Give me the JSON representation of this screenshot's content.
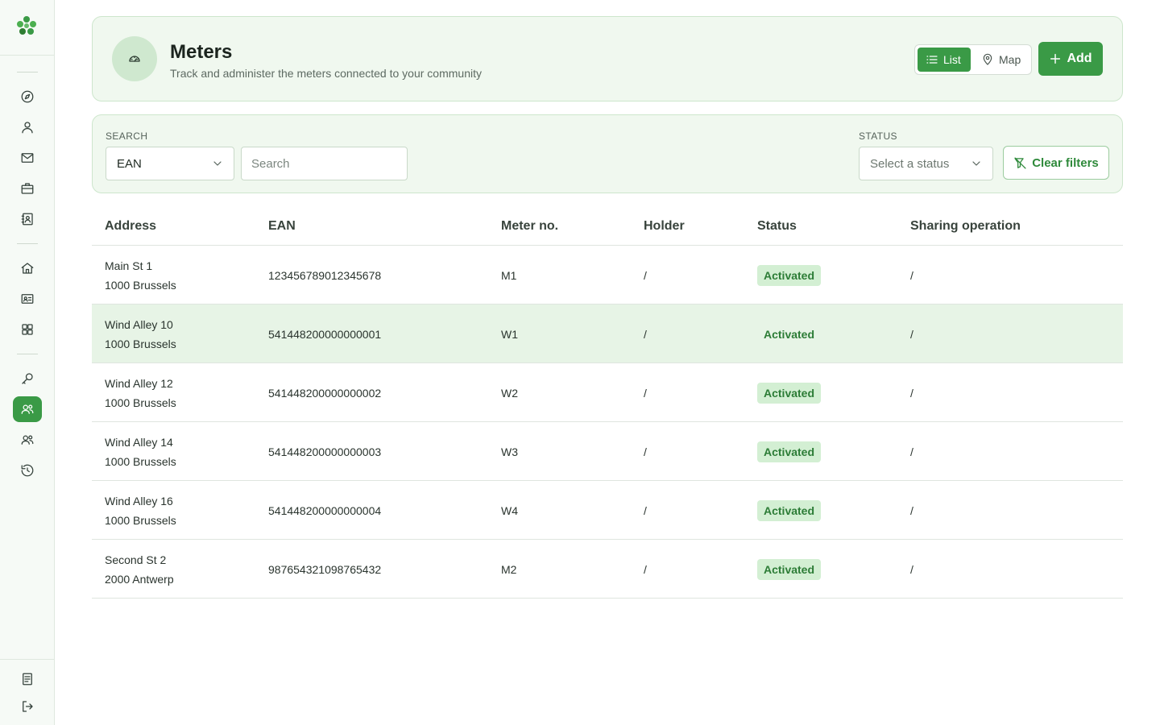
{
  "sidebar": {
    "icons": [
      "compass-icon",
      "user-icon",
      "mail-icon",
      "briefcase-icon",
      "contacts-icon",
      "home-icon",
      "id-card-icon",
      "grid-icon",
      "key-icon",
      "users-icon",
      "group-icon",
      "history-icon",
      "document-icon",
      "logout-icon"
    ],
    "active": "users-icon"
  },
  "header": {
    "title": "Meters",
    "subtitle": "Track and administer the meters connected to your community",
    "view_list_label": "List",
    "view_map_label": "Map",
    "add_label": "Add"
  },
  "filters": {
    "search_label": "SEARCH",
    "search_field_value": "EAN",
    "search_placeholder": "Search",
    "status_label": "STATUS",
    "status_placeholder": "Select a status",
    "clear_label": "Clear filters"
  },
  "table": {
    "columns": [
      "Address",
      "EAN",
      "Meter no.",
      "Holder",
      "Status",
      "Sharing operation"
    ],
    "rows": [
      {
        "address_line1": "Main St 1",
        "address_line2": "1000 Brussels",
        "ean": "123456789012345678",
        "meter": "M1",
        "holder": "/",
        "status": "Activated",
        "sharing": "/"
      },
      {
        "address_line1": "Wind Alley 10",
        "address_line2": "1000 Brussels",
        "ean": "541448200000000001",
        "meter": "W1",
        "holder": "/",
        "status": "Activated",
        "sharing": "/"
      },
      {
        "address_line1": "Wind Alley 12",
        "address_line2": "1000 Brussels",
        "ean": "541448200000000002",
        "meter": "W2",
        "holder": "/",
        "status": "Activated",
        "sharing": "/"
      },
      {
        "address_line1": "Wind Alley 14",
        "address_line2": "1000 Brussels",
        "ean": "541448200000000003",
        "meter": "W3",
        "holder": "/",
        "status": "Activated",
        "sharing": "/"
      },
      {
        "address_line1": "Wind Alley 16",
        "address_line2": "1000 Brussels",
        "ean": "541448200000000004",
        "meter": "W4",
        "holder": "/",
        "status": "Activated",
        "sharing": "/"
      },
      {
        "address_line1": "Second St 2",
        "address_line2": "2000 Antwerp",
        "ean": "987654321098765432",
        "meter": "M2",
        "holder": "/",
        "status": "Activated",
        "sharing": "/"
      }
    ]
  },
  "colors": {
    "accent": "#3a9a46",
    "accent_light": "#f0f8ef",
    "badge_bg": "#d3efd3",
    "badge_text": "#2c7c36",
    "row_highlight": "#e7f4e6"
  }
}
